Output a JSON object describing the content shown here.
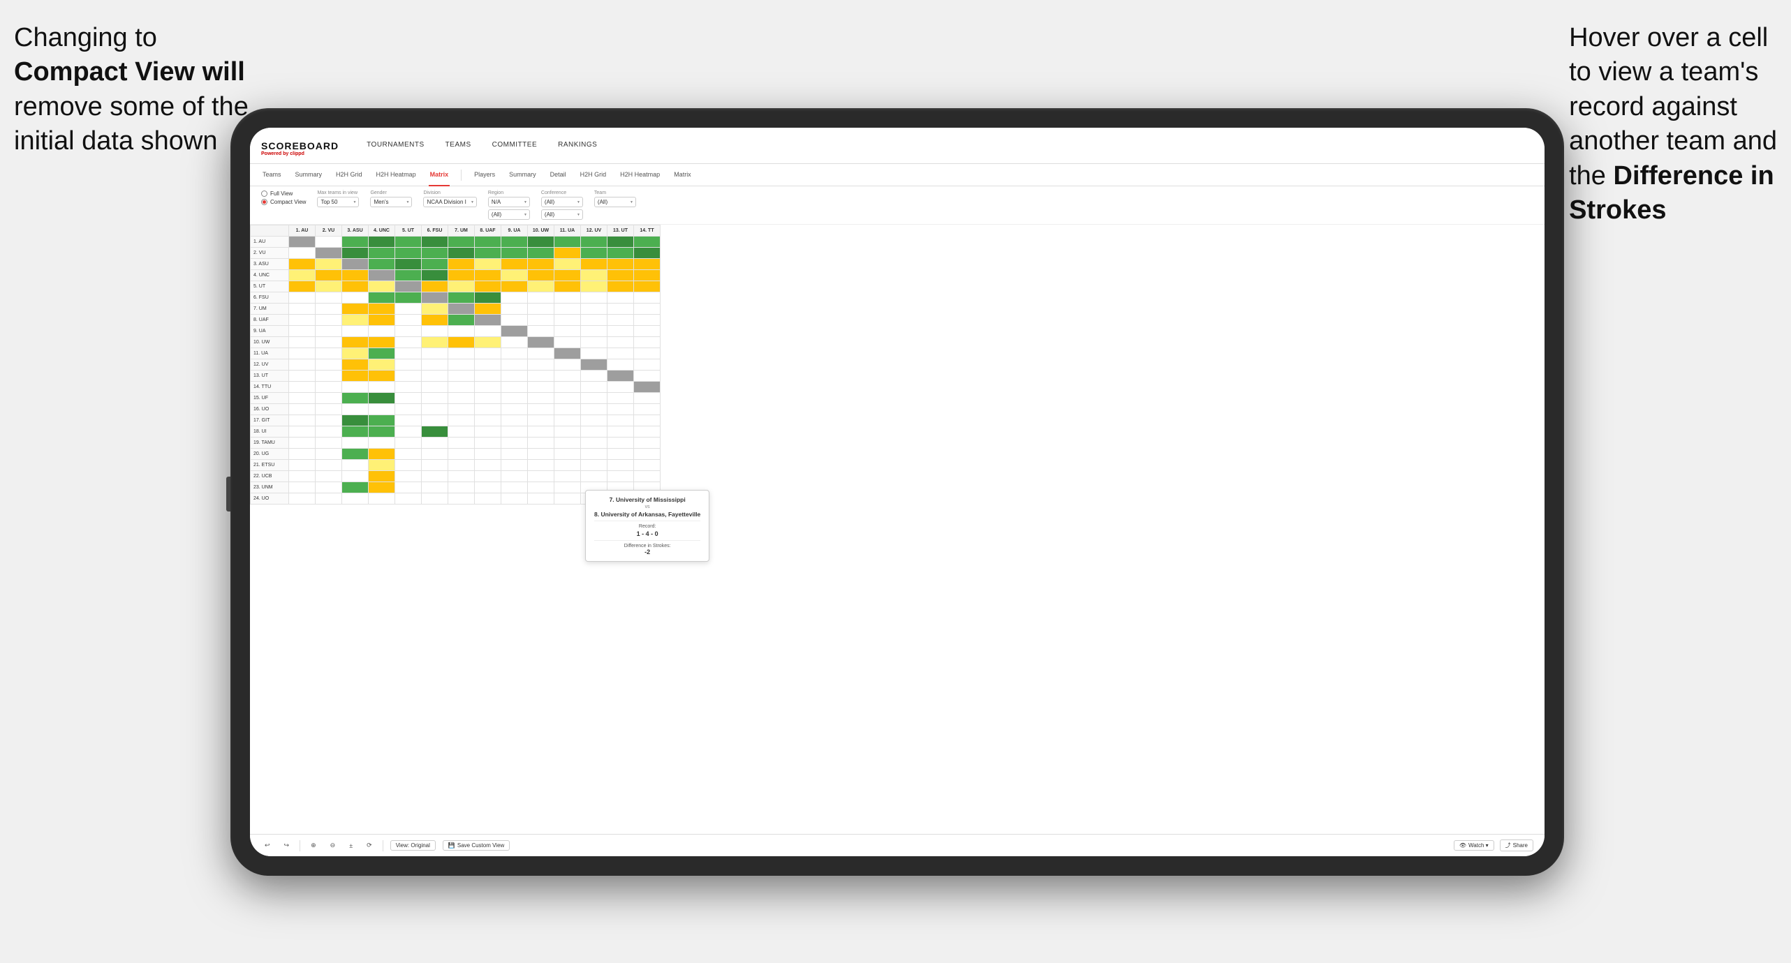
{
  "annotations": {
    "left": {
      "line1": "Changing to",
      "line2": "Compact View will",
      "line3": "remove some of the",
      "line4": "initial data shown"
    },
    "right": {
      "line1": "Hover over a cell",
      "line2": "to view a team's",
      "line3": "record against",
      "line4": "another team and",
      "line5": "the ",
      "line5_bold": "Difference in",
      "line6": "Strokes"
    }
  },
  "brand": {
    "name": "SCOREBOARD",
    "sub": "Powered by clippd"
  },
  "nav": {
    "items": [
      "TOURNAMENTS",
      "TEAMS",
      "COMMITTEE",
      "RANKINGS"
    ]
  },
  "subnav": {
    "left": [
      "Teams",
      "Summary",
      "H2H Grid",
      "H2H Heatmap",
      "Matrix"
    ],
    "right": [
      "Players",
      "Summary",
      "Detail",
      "H2H Grid",
      "H2H Heatmap",
      "Matrix"
    ],
    "active": "Matrix"
  },
  "view_options": {
    "full_view": "Full View",
    "compact_view": "Compact View",
    "selected": "compact"
  },
  "filters": {
    "max_teams_label": "Max teams in view",
    "max_teams_value": "Top 50",
    "gender_label": "Gender",
    "gender_value": "Men's",
    "division_label": "Division",
    "division_value": "NCAA Division I",
    "region_label": "Region",
    "region_value": "N/A",
    "conference_label": "Conference",
    "conference_value1": "(All)",
    "conference_value2": "(All)",
    "team_label": "Team",
    "team_value": "(All)"
  },
  "matrix": {
    "col_headers": [
      "",
      "1. AU",
      "2. VU",
      "3. ASU",
      "4. UNC",
      "5. UT",
      "6. FSU",
      "7. UM",
      "8. UAF",
      "9. UA",
      "10. UW",
      "11. UA",
      "12. UV",
      "13. UT",
      "14. TT"
    ],
    "rows": [
      {
        "label": "1. AU",
        "cells": [
          "diag",
          "",
          "green",
          "green",
          "green",
          "green",
          "green",
          "green",
          "green",
          "green",
          "green",
          "green",
          "green",
          "green"
        ]
      },
      {
        "label": "2. VU",
        "cells": [
          "",
          "diag",
          "green",
          "green",
          "green",
          "green",
          "green",
          "green",
          "green",
          "green",
          "yellow",
          "green",
          "green",
          "green"
        ]
      },
      {
        "label": "3. ASU",
        "cells": [
          "yellow",
          "yellow",
          "diag",
          "green",
          "green",
          "green",
          "yellow",
          "yellow",
          "yellow",
          "yellow",
          "yellow",
          "yellow",
          "yellow",
          "yellow"
        ]
      },
      {
        "label": "4. UNC",
        "cells": [
          "yellow",
          "yellow",
          "yellow",
          "diag",
          "green",
          "green",
          "yellow",
          "yellow",
          "yellow",
          "yellow",
          "yellow",
          "yellow",
          "yellow",
          "yellow"
        ]
      },
      {
        "label": "5. UT",
        "cells": [
          "yellow",
          "yellow",
          "yellow",
          "yellow",
          "diag",
          "yellow",
          "yellow",
          "yellow",
          "yellow",
          "yellow",
          "yellow",
          "yellow",
          "yellow",
          "yellow"
        ]
      },
      {
        "label": "6. FSU",
        "cells": [
          "",
          "",
          "",
          "green",
          "green",
          "diag",
          "green",
          "green",
          "",
          "",
          "",
          "",
          "",
          ""
        ]
      },
      {
        "label": "7. UM",
        "cells": [
          "",
          "",
          "yellow",
          "yellow",
          "",
          "yellow",
          "diag",
          "yellow",
          "",
          "",
          "",
          "",
          "",
          ""
        ]
      },
      {
        "label": "8. UAF",
        "cells": [
          "",
          "",
          "yellow",
          "yellow",
          "",
          "yellow",
          "green",
          "diag",
          "",
          "",
          "",
          "",
          "",
          ""
        ]
      },
      {
        "label": "9. UA",
        "cells": [
          "",
          "",
          "",
          "",
          "",
          "",
          "",
          "",
          "diag",
          "",
          "",
          "",
          "",
          ""
        ]
      },
      {
        "label": "10. UW",
        "cells": [
          "white",
          "white",
          "yellow",
          "yellow",
          "white",
          "yellow",
          "yellow",
          "yellow",
          "white",
          "diag",
          "white",
          "white",
          "white",
          "white"
        ]
      },
      {
        "label": "11. UA",
        "cells": [
          "",
          "",
          "yellow",
          "green",
          "",
          "",
          "",
          "",
          "",
          "",
          "diag",
          "",
          "",
          ""
        ]
      },
      {
        "label": "12. UV",
        "cells": [
          "",
          "",
          "yellow",
          "yellow",
          "",
          "",
          "",
          "",
          "",
          "",
          "",
          "diag",
          "",
          ""
        ]
      },
      {
        "label": "13. UT",
        "cells": [
          "",
          "",
          "yellow",
          "yellow",
          "",
          "",
          "",
          "",
          "",
          "",
          "",
          "",
          "diag",
          ""
        ]
      },
      {
        "label": "14. TTU",
        "cells": [
          "white",
          "white",
          "white",
          "white",
          "white",
          "white",
          "white",
          "white",
          "white",
          "white",
          "white",
          "white",
          "white",
          "diag"
        ]
      },
      {
        "label": "15. UF",
        "cells": [
          "",
          "",
          "green",
          "green",
          "",
          "",
          "",
          "",
          "",
          "",
          "",
          "",
          "",
          ""
        ]
      },
      {
        "label": "16. UO",
        "cells": [
          "",
          "",
          "",
          "",
          "",
          "",
          "",
          "",
          "",
          "",
          "",
          "",
          "",
          ""
        ]
      },
      {
        "label": "17. GIT",
        "cells": [
          "",
          "",
          "green",
          "green",
          "",
          "",
          "",
          "",
          "",
          "",
          "",
          "",
          "",
          ""
        ]
      },
      {
        "label": "18. UI",
        "cells": [
          "",
          "",
          "green",
          "green",
          "",
          "green",
          "",
          "",
          "",
          "",
          "",
          "",
          "",
          ""
        ]
      },
      {
        "label": "19. TAMU",
        "cells": [
          "",
          "",
          "",
          "",
          "",
          "",
          "",
          "",
          "",
          "",
          "",
          "",
          "",
          ""
        ]
      },
      {
        "label": "20. UG",
        "cells": [
          "",
          "",
          "green",
          "yellow",
          "",
          "",
          "",
          "",
          "",
          "",
          "",
          "",
          "",
          ""
        ]
      },
      {
        "label": "21. ETSU",
        "cells": [
          "",
          "",
          "",
          "yellow",
          "",
          "",
          "",
          "",
          "",
          "",
          "",
          "",
          "",
          ""
        ]
      },
      {
        "label": "22. UCB",
        "cells": [
          "",
          "",
          "",
          "yellow",
          "",
          "",
          "",
          "",
          "",
          "",
          "",
          "",
          "",
          ""
        ]
      },
      {
        "label": "23. UNM",
        "cells": [
          "",
          "",
          "green",
          "yellow",
          "",
          "",
          "",
          "",
          "",
          "",
          "",
          "",
          "",
          ""
        ]
      },
      {
        "label": "24. UO",
        "cells": [
          "",
          "",
          "",
          "",
          "",
          "",
          "",
          "",
          "",
          "",
          "",
          "",
          "",
          ""
        ]
      }
    ]
  },
  "tooltip": {
    "team1": "7. University of Mississippi",
    "vs": "vs",
    "team2": "8. University of Arkansas, Fayetteville",
    "record_label": "Record:",
    "record_value": "1 - 4 - 0",
    "diff_label": "Difference in Strokes:",
    "diff_value": "-2"
  },
  "toolbar": {
    "undo": "↩",
    "redo": "↪",
    "icons": [
      "↩",
      "↪",
      "⊕",
      "⊖",
      "±",
      "⟳"
    ],
    "view_original": "View: Original",
    "save_custom": "Save Custom View",
    "watch": "Watch ▾",
    "share": "Share"
  }
}
